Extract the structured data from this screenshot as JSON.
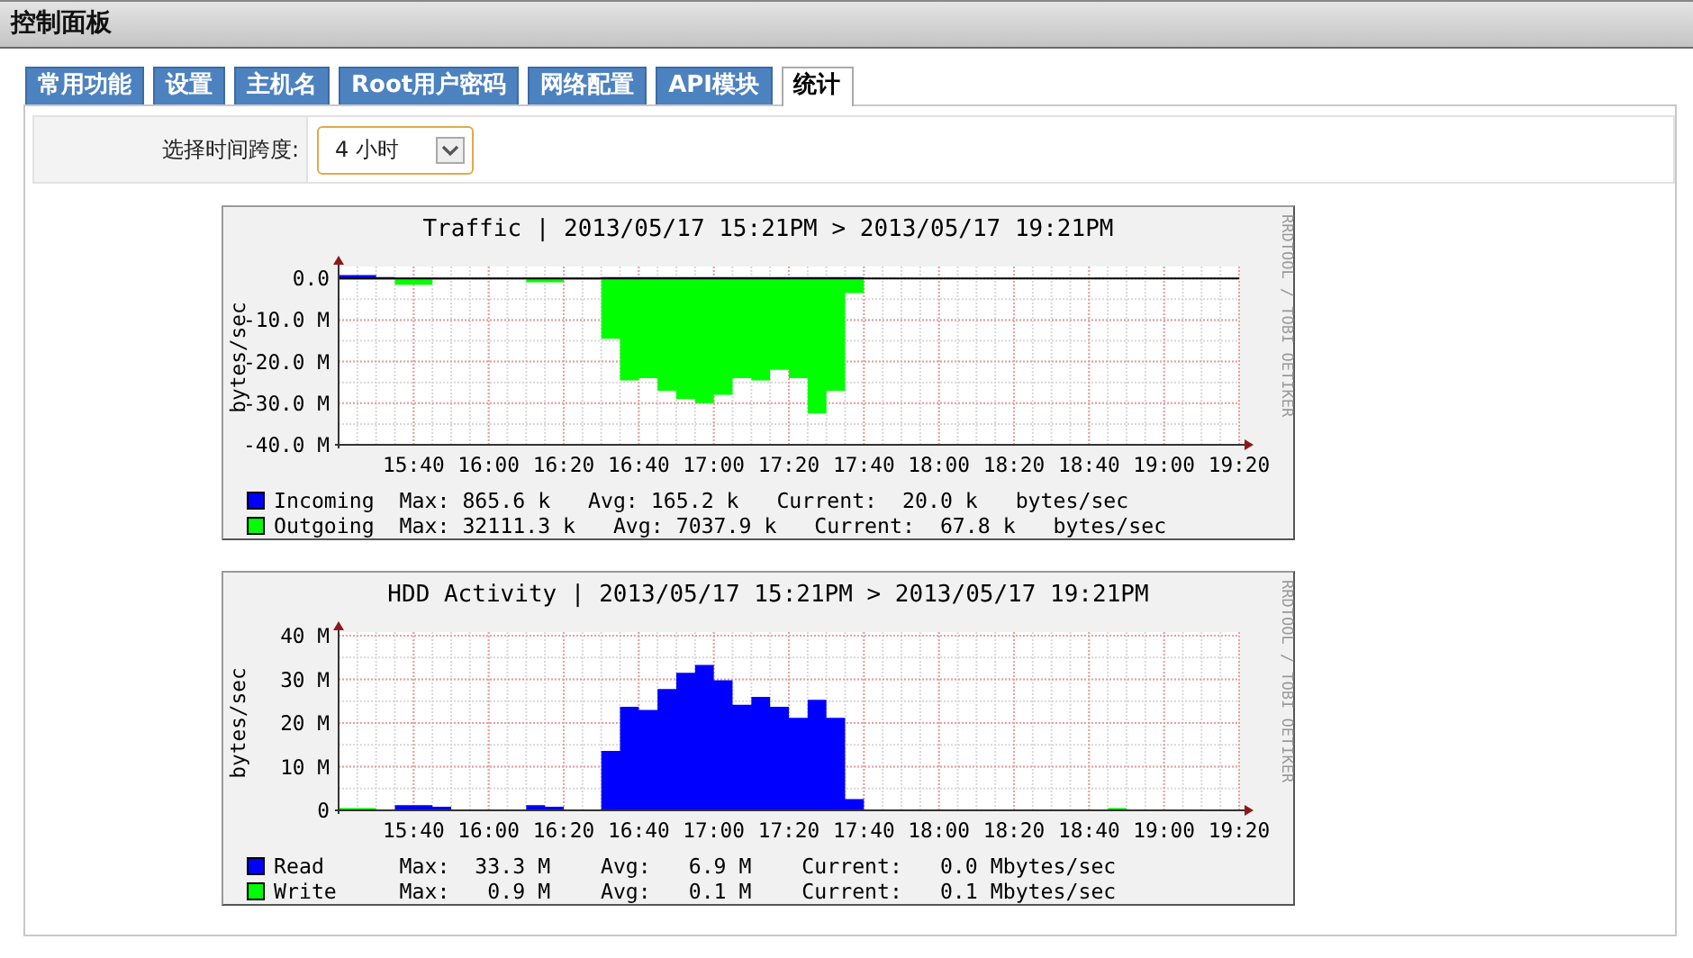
{
  "header": {
    "title": "控制面板"
  },
  "tabs": [
    {
      "label": "常用功能",
      "selected": false
    },
    {
      "label": "设置",
      "selected": false
    },
    {
      "label": "主机名",
      "selected": false
    },
    {
      "label": "Root用户密码",
      "selected": false
    },
    {
      "label": "网络配置",
      "selected": false
    },
    {
      "label": "API模块",
      "selected": false
    },
    {
      "label": "统计",
      "selected": true
    }
  ],
  "time_span": {
    "label": "选择时间跨度:",
    "value": "4 小时"
  },
  "graphs": [
    {
      "credit": "RRDTOOL / TOBI OETIKER",
      "legend": [
        {
          "stats": "Max: 865.6 k   Avg: 165.2 k   Current:  20.0 k   bytes/sec"
        },
        {
          "stats": "Max: 32111.3 k   Avg: 7037.9 k   Current:  67.8 k   bytes/sec"
        }
      ],
      "chart_data": {
        "type": "area",
        "title": "Traffic | 2013/05/17 15:21PM > 2013/05/17 19:21PM",
        "ylabel": "bytes/sec",
        "categories": [
          null,
          null,
          null,
          null,
          "15:40",
          null,
          null,
          null,
          "16:00",
          null,
          null,
          null,
          "16:20",
          null,
          null,
          null,
          "16:40",
          null,
          null,
          null,
          "17:00",
          null,
          null,
          null,
          "17:20",
          null,
          null,
          null,
          "17:40",
          null,
          null,
          null,
          "18:00",
          null,
          null,
          null,
          "18:20",
          null,
          null,
          null,
          "18:40",
          null,
          null,
          null,
          "19:00",
          null,
          null,
          null,
          "19:20"
        ],
        "ylim": [
          -40,
          2
        ],
        "grid": true,
        "yticks": [
          {
            "value": 0,
            "label": "0.0"
          },
          {
            "value": -10,
            "label": "-10.0 M"
          },
          {
            "value": -20,
            "label": "-20.0 M"
          },
          {
            "value": -30,
            "label": "-30.0 M"
          },
          {
            "value": -40,
            "label": "-40.0 M"
          }
        ],
        "series": [
          {
            "name": "Incoming",
            "color": "#0000ff",
            "values": [
              0.8,
              0.8,
              0.3,
              0.1,
              0.1,
              0.1,
              0.1,
              0.1,
              0.1,
              0.1,
              0.1,
              0.1,
              0.1,
              0.1,
              0.3,
              0.3,
              0.3,
              0.3,
              0.3,
              0.3,
              0.3,
              0.3,
              0.3,
              0.3,
              0.3,
              0.3,
              0.3,
              0.3,
              0,
              0,
              0,
              0,
              0,
              0,
              0,
              0,
              0,
              0,
              0,
              0,
              0,
              0,
              0,
              0,
              0,
              0,
              0,
              0,
              0
            ]
          },
          {
            "name": "Outgoing",
            "color": "#00ff00",
            "values": [
              -0.3,
              -0.3,
              -0.3,
              -1.5,
              -1.5,
              -0.3,
              -0.2,
              -0.2,
              -0.2,
              -0.2,
              -0.9,
              -0.9,
              -0.3,
              -0.3,
              -14.5,
              -24.5,
              -24,
              -27,
              -29,
              -30,
              -28,
              -24,
              -24.5,
              -22,
              -24,
              -32.5,
              -27,
              -3.5,
              -0.1,
              -0.1,
              -0.1,
              -0.1,
              -0.1,
              -0.1,
              -0.1,
              -0.1,
              -0.1,
              -0.1,
              -0.1,
              -0.1,
              -0.1,
              -0.1,
              -0.1,
              -0.1,
              -0.1,
              -0.1,
              -0.1,
              -0.1,
              -0.1
            ]
          }
        ]
      }
    },
    {
      "credit": "RRDTOOL / TOBI OETIKER",
      "legend": [
        {
          "stats": "Max:  33.3 M    Avg:   6.9 M    Current:   0.0 Mbytes/sec"
        },
        {
          "stats": "Max:   0.9 M    Avg:   0.1 M    Current:   0.1 Mbytes/sec"
        }
      ],
      "chart_data": {
        "type": "area",
        "title": "HDD Activity | 2013/05/17 15:21PM > 2013/05/17 19:21PM",
        "ylabel": "bytes/sec",
        "categories": [
          null,
          null,
          null,
          null,
          "15:40",
          null,
          null,
          null,
          "16:00",
          null,
          null,
          null,
          "16:20",
          null,
          null,
          null,
          "16:40",
          null,
          null,
          null,
          "17:00",
          null,
          null,
          null,
          "17:20",
          null,
          null,
          null,
          "17:40",
          null,
          null,
          null,
          "18:00",
          null,
          null,
          null,
          "18:20",
          null,
          null,
          null,
          "18:40",
          null,
          null,
          null,
          "19:00",
          null,
          null,
          null,
          "19:20"
        ],
        "ylim": [
          0,
          40
        ],
        "grid": true,
        "yticks": [
          {
            "value": 0,
            "label": "0"
          },
          {
            "value": 10,
            "label": "10 M"
          },
          {
            "value": 20,
            "label": "20 M"
          },
          {
            "value": 30,
            "label": "30 M"
          },
          {
            "value": 40,
            "label": "40 M"
          }
        ],
        "series": [
          {
            "name": "Read",
            "color": "#0000ff",
            "values": [
              0,
              0,
              0,
              1.2,
              1.2,
              0.8,
              0,
              0,
              0,
              0,
              1.2,
              0.8,
              0,
              0,
              13.6,
              23.7,
              23,
              27.8,
              31.5,
              33.3,
              29.8,
              24.2,
              26,
              23.7,
              21.2,
              25.3,
              21.2,
              2.6,
              0,
              0,
              0,
              0,
              0,
              0,
              0,
              0,
              0,
              0,
              0,
              0,
              0,
              0,
              0,
              0,
              0,
              0,
              0,
              0,
              0
            ]
          },
          {
            "name": "Write",
            "color": "#00ff00",
            "values": [
              0.5,
              0.5,
              0.1,
              0.1,
              0.1,
              0.1,
              0.1,
              0.1,
              0.1,
              0.1,
              0.1,
              0.1,
              0.1,
              0.1,
              0.1,
              0.1,
              0.1,
              0.1,
              0.1,
              0.1,
              0.1,
              0.1,
              0.1,
              0.1,
              0.1,
              0.1,
              0.1,
              0.1,
              0.1,
              0.1,
              0.1,
              0.1,
              0.1,
              0.1,
              0.1,
              0.1,
              0.1,
              0.1,
              0.1,
              0.1,
              0.1,
              0.5,
              0.1,
              0.1,
              0.1,
              0.1,
              0.1,
              0.1,
              0.1
            ]
          }
        ]
      }
    }
  ]
}
